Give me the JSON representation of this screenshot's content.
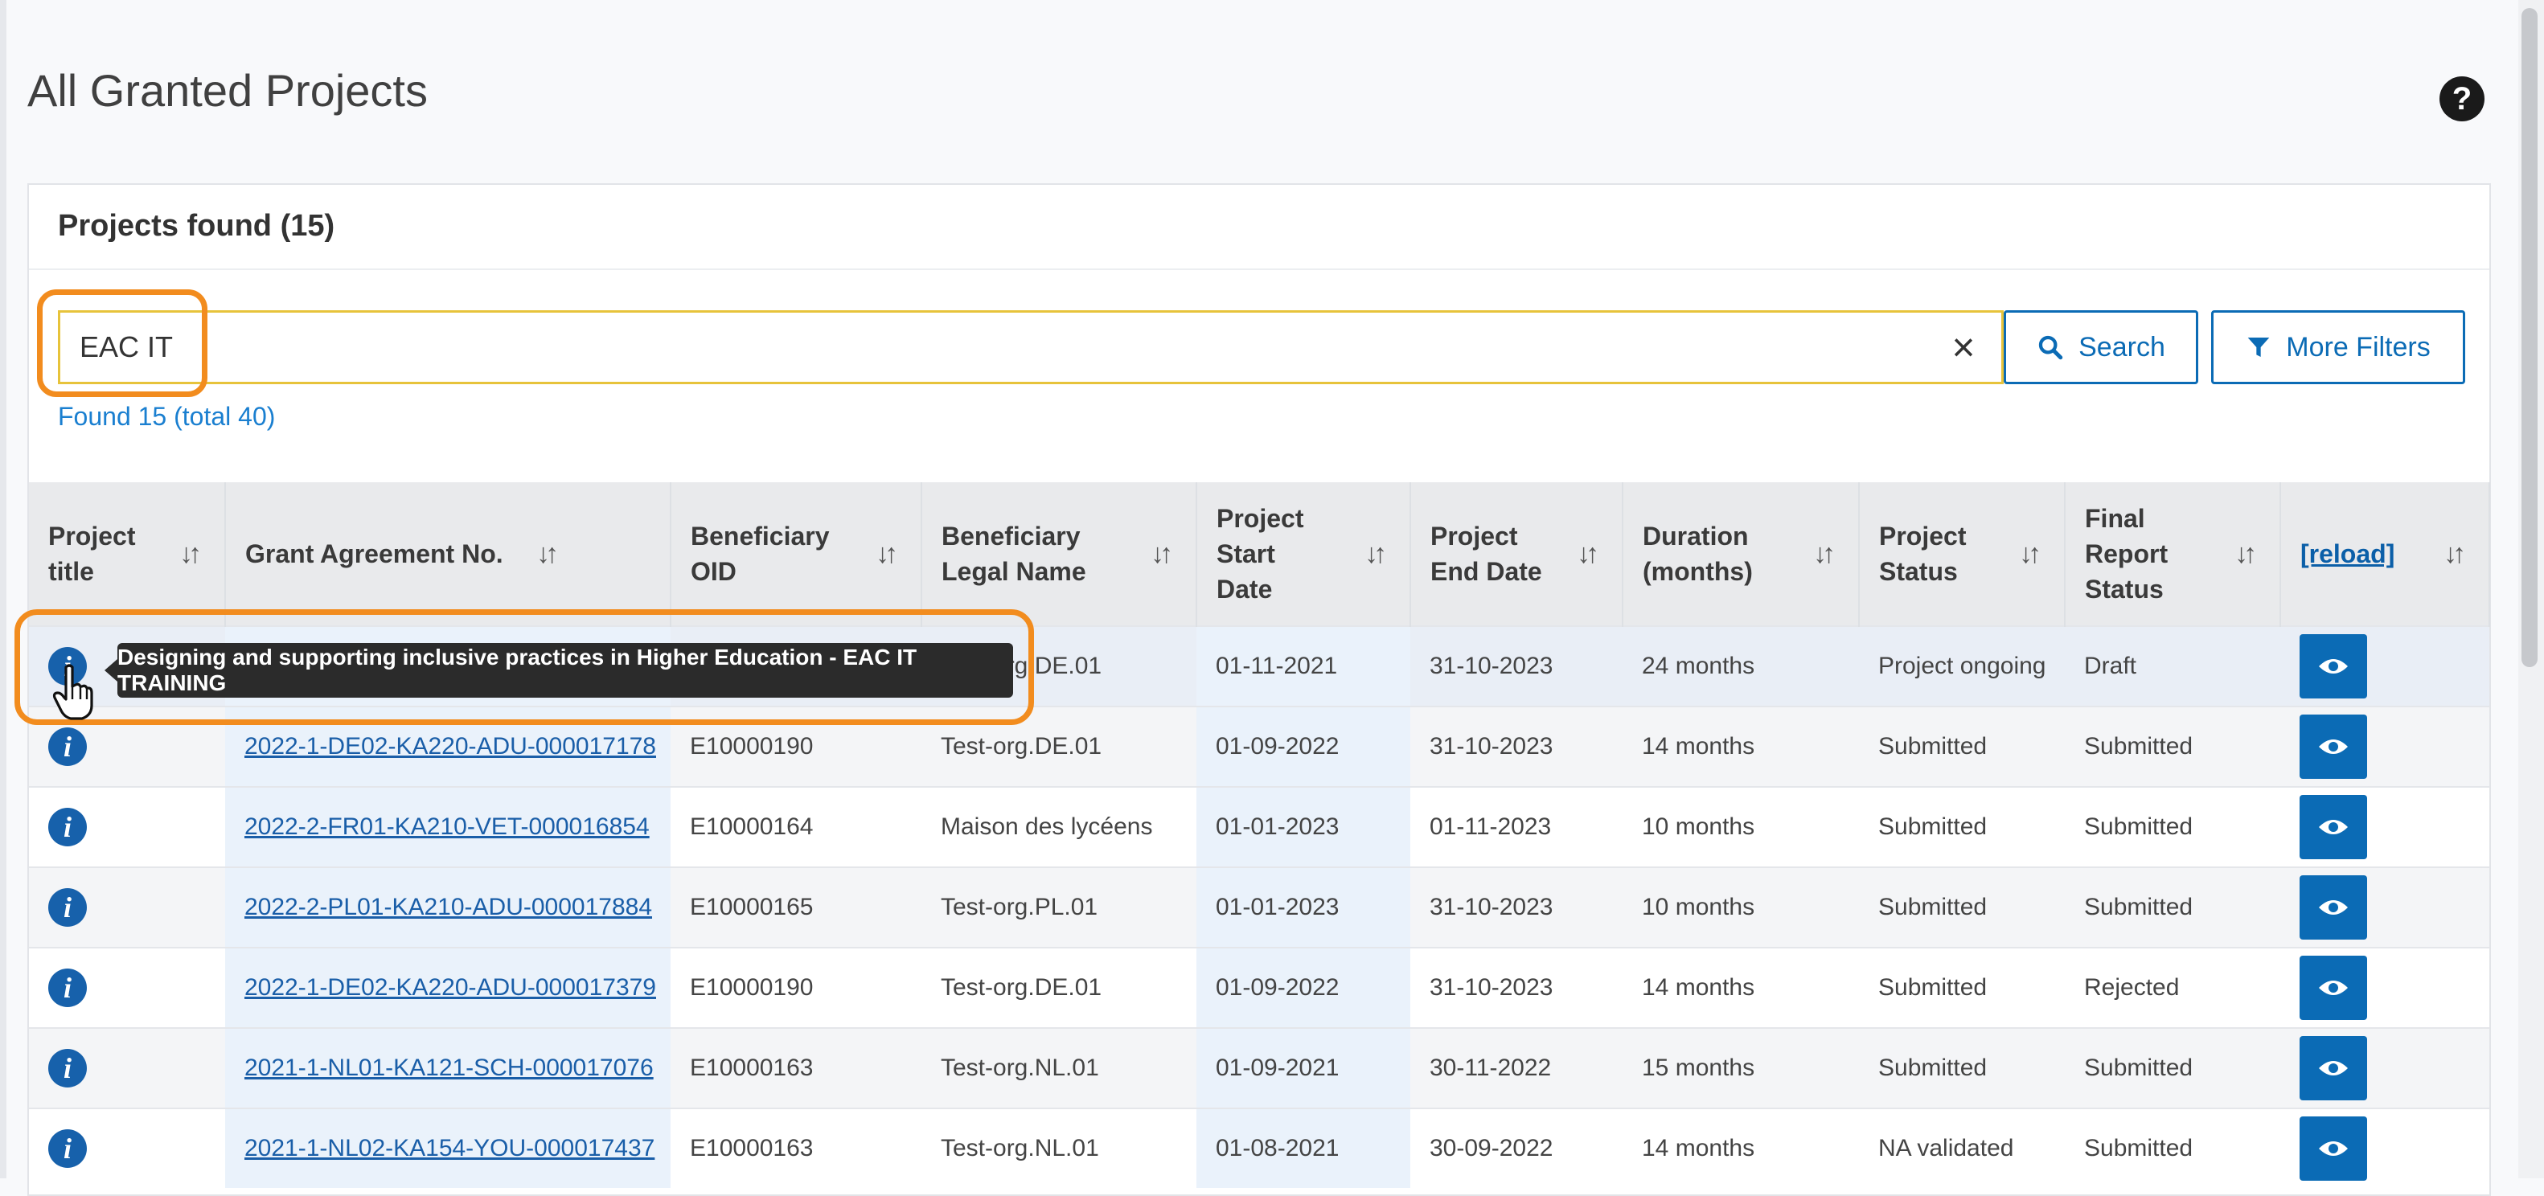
{
  "page": {
    "title": "All Granted Projects",
    "help_icon": "question-circle-icon"
  },
  "panel": {
    "title": "Projects found (15)"
  },
  "search": {
    "value": "EAC IT",
    "search_label": "Search",
    "filters_label": "More Filters",
    "found_text": "Found 15 (total 40)"
  },
  "table": {
    "headers": [
      "Project title",
      "Grant Agreement No.",
      "Beneficiary OID",
      "Beneficiary Legal Name",
      "Project Start Date",
      "Project End Date",
      "Duration (months)",
      "Project Status",
      "Final Report Status",
      "[reload]"
    ],
    "rows": [
      {
        "ga": "",
        "oid": "",
        "legal": "Test-org.DE.01",
        "start": "01-11-2021",
        "end": "31-10-2023",
        "duration": "24 months",
        "status": "Project ongoing",
        "report": "Draft"
      },
      {
        "ga": "2022-1-DE02-KA220-ADU-000017178",
        "oid": "E10000190",
        "legal": "Test-org.DE.01",
        "start": "01-09-2022",
        "end": "31-10-2023",
        "duration": "14 months",
        "status": "Submitted",
        "report": "Submitted"
      },
      {
        "ga": "2022-2-FR01-KA210-VET-000016854",
        "oid": "E10000164",
        "legal": "Maison des lycéens",
        "start": "01-01-2023",
        "end": "01-11-2023",
        "duration": "10 months",
        "status": "Submitted",
        "report": "Submitted"
      },
      {
        "ga": "2022-2-PL01-KA210-ADU-000017884",
        "oid": "E10000165",
        "legal": "Test-org.PL.01",
        "start": "01-01-2023",
        "end": "31-10-2023",
        "duration": "10 months",
        "status": "Submitted",
        "report": "Submitted"
      },
      {
        "ga": "2022-1-DE02-KA220-ADU-000017379",
        "oid": "E10000190",
        "legal": "Test-org.DE.01",
        "start": "01-09-2022",
        "end": "31-10-2023",
        "duration": "14 months",
        "status": "Submitted",
        "report": "Rejected"
      },
      {
        "ga": "2021-1-NL01-KA121-SCH-000017076",
        "oid": "E10000163",
        "legal": "Test-org.NL.01",
        "start": "01-09-2021",
        "end": "30-11-2022",
        "duration": "15 months",
        "status": "Submitted",
        "report": "Submitted"
      },
      {
        "ga": "2021-1-NL02-KA154-YOU-000017437",
        "oid": "E10000163",
        "legal": "Test-org.NL.01",
        "start": "01-08-2021",
        "end": "30-09-2022",
        "duration": "14 months",
        "status": "NA validated",
        "report": "Submitted"
      }
    ]
  },
  "tooltip": {
    "text": "Designing and supporting inclusive practices in Higher Education - EAC IT TRAINING"
  },
  "colors": {
    "primary": "#0b6bb5",
    "highlight": "#f28c1e",
    "search_border": "#e7c33b",
    "link": "#1a7fd0"
  }
}
